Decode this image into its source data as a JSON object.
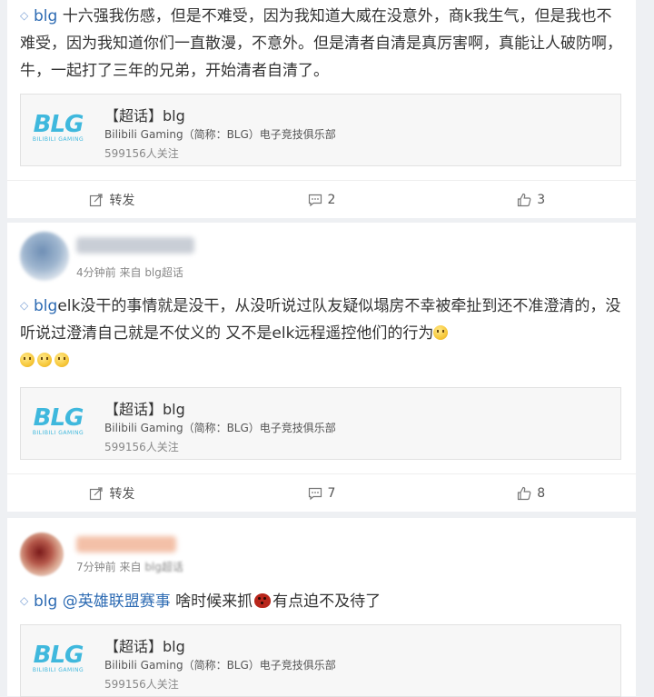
{
  "posts": [
    {
      "tag": "blg",
      "text": " 十六强我伤感，但是不难受，因为我知道大威在没意外，商k我生气，但是我也不难受，因为我知道你们一直散漫，不意外。但是清者自清是真厉害啊，真能让人破防啊，牛，一起打了三年的兄弟，开始清者自清了。",
      "topic": {
        "title": "【超话】blg",
        "subtitle": "Bilibili Gaming（简称：BLG）电子竞技俱乐部",
        "followers": "599156人关注"
      },
      "actions": {
        "repost": "转发",
        "comments": "2",
        "likes": "3"
      }
    },
    {
      "time": "4分钟前",
      "from_label": "来自",
      "source": "blg超话",
      "tag": "blg",
      "text": "elk没干的事情就是没干，从没听说过队友疑似塌房不幸被牵扯到还不准澄清的，没听说过澄清自己就是不仗义的 又不是elk远程遥控他们的行为",
      "topic": {
        "title": "【超话】blg",
        "subtitle": "Bilibili Gaming（简称：BLG）电子竞技俱乐部",
        "followers": "599156人关注"
      },
      "actions": {
        "repost": "转发",
        "comments": "7",
        "likes": "8"
      }
    },
    {
      "time": "7分钟前",
      "from_label": "来自",
      "source": "blg超话",
      "tag": "blg",
      "mention": "@英雄联盟赛事",
      "text_a": " 啥时候来抓",
      "text_b": "有点迫不及待了",
      "topic": {
        "title": "【超话】blg",
        "subtitle": "Bilibili Gaming（简称：BLG）电子竞技俱乐部",
        "followers": "599156人关注"
      }
    }
  ],
  "logo": {
    "big": "BLG",
    "small": "BILIBILI GAMING"
  },
  "colors": {
    "link": "#2d6bb3",
    "logo": "#3fb8dd",
    "background": "#eef0f3"
  }
}
